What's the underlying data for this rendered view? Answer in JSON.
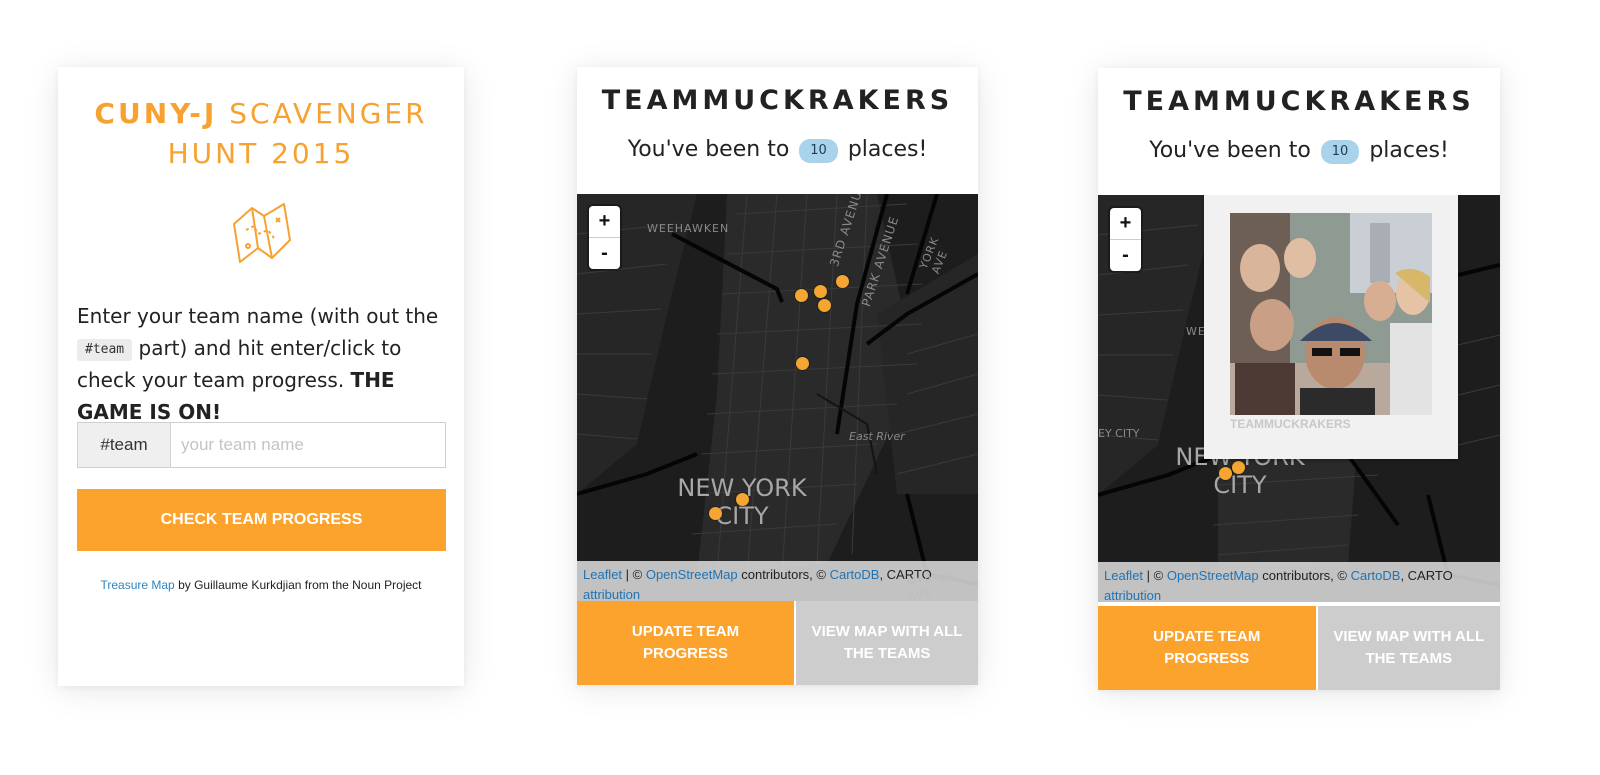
{
  "colors": {
    "accent": "#fca32d",
    "title_orange": "#f7a230",
    "grey_button": "#cdcdcd",
    "map_bg": "#1d1d1d",
    "marker": "#f5a531",
    "badge": "#a8d3ea"
  },
  "home": {
    "title_bold": "CUNY-J",
    "title_rest": " SCAVENGER HUNT 2015",
    "icon": "treasure-map-icon",
    "intro_pre": "Enter your team name (with out the ",
    "intro_chip": "#team",
    "intro_post": " part) and hit enter/click to check your team progress. ",
    "intro_bold": "THE GAME IS ON!",
    "input_addon": "#team",
    "input_placeholder": "your team name",
    "input_value": "",
    "button_label": "CHECK TEAM PROGRESS",
    "credit_link": "Treasure Map",
    "credit_rest": " by Guillaume Kurkdjian from the Noun Project"
  },
  "progress": {
    "team_name": "TEAMMUCKRAKERS",
    "places_pre": "You've been to ",
    "places_count": "10",
    "places_post": " places!",
    "zoom_in": "+",
    "zoom_out": "-",
    "map_labels": [
      "WEEHAWKEN",
      "3RD AVENUE",
      "PARK AVENUE",
      "YORK AVE",
      "East River",
      "NEW YORK CITY",
      "MYRTLE AVE"
    ],
    "city_line1": "NEW YORK",
    "city_line2": "CITY",
    "attrib_leaflet": "Leaflet",
    "attrib_sep": " | © ",
    "attrib_osm": "OpenStreetMap",
    "attrib_mid": " contributors, © ",
    "attrib_carto": "CartoDB",
    "attrib_end": ", CARTO",
    "attrib_link2": "attribution",
    "update_button": "UPDATE TEAM PROGRESS",
    "view_all_button": "VIEW MAP WITH ALL THE TEAMS",
    "popup_caption": "TEAMMUCKRAKERS",
    "label_weeh_short": "WEEH",
    "label_ey_city": "EY CITY"
  }
}
